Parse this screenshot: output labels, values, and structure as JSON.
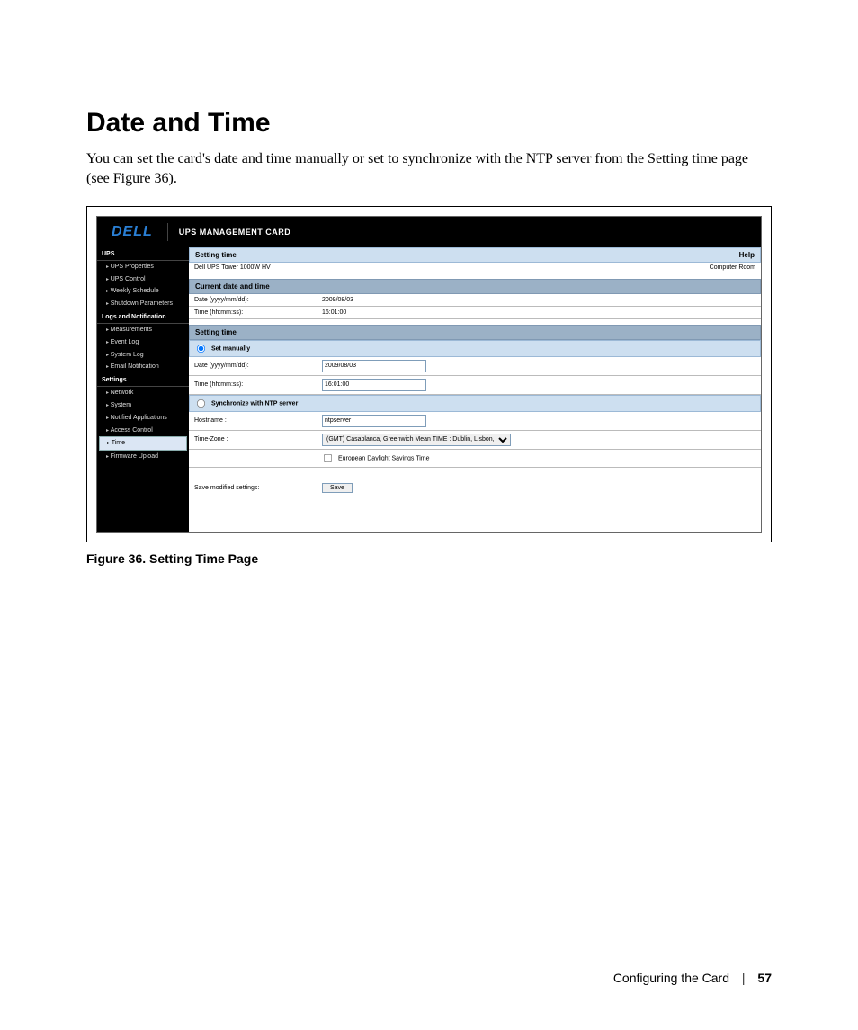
{
  "heading": "Date and Time",
  "intro": "You can set the card's date and time manually or set to synchronize with the NTP server from the Setting time page (see Figure 36).",
  "figure_caption": "Figure 36. Setting Time Page",
  "footer": {
    "section": "Configuring the Card",
    "page": "57"
  },
  "card": {
    "logo": "DELL",
    "title": "UPS MANAGEMENT CARD",
    "content": {
      "title_bar": {
        "title": "Setting time",
        "help": "Help"
      },
      "device_row": {
        "name": "Dell UPS Tower 1000W HV",
        "location": "Computer Room"
      },
      "current_section": "Current date and time",
      "current_date_label": "Date (yyyy/mm/dd):",
      "current_date_value": "2009/08/03",
      "current_time_label": "Time (hh:mm:ss):",
      "current_time_value": "16:01:00",
      "setting_section": "Setting time",
      "set_manually_label": "Set manually",
      "set_date_label": "Date (yyyy/mm/dd):",
      "set_date_value": "2009/08/03",
      "set_time_label": "Time (hh:mm:ss):",
      "set_time_value": "16:01:00",
      "sync_ntp_label": "Synchronize with NTP server",
      "hostname_label": "Hostname :",
      "hostname_value": "ntpserver",
      "timezone_label": "Time-Zone :",
      "timezone_value": "(GMT) Casablanca, Greenwich Mean TIME : Dublin, Lisbon, London",
      "dst_label": "European Daylight Savings Time",
      "save_label": "Save modified settings:",
      "save_button": "Save"
    },
    "sidebar": {
      "group1": "UPS",
      "g1_items": [
        "UPS Properties",
        "UPS Control",
        "Weekly Schedule",
        "Shutdown Parameters"
      ],
      "group2": "Logs and Notification",
      "g2_items": [
        "Measurements",
        "Event Log",
        "System Log",
        "Email Notification"
      ],
      "group3": "Settings",
      "g3_items": [
        "Network",
        "System",
        "Notified Applications",
        "Access Control",
        "Time",
        "Firmware Upload"
      ],
      "active": "Time"
    }
  }
}
